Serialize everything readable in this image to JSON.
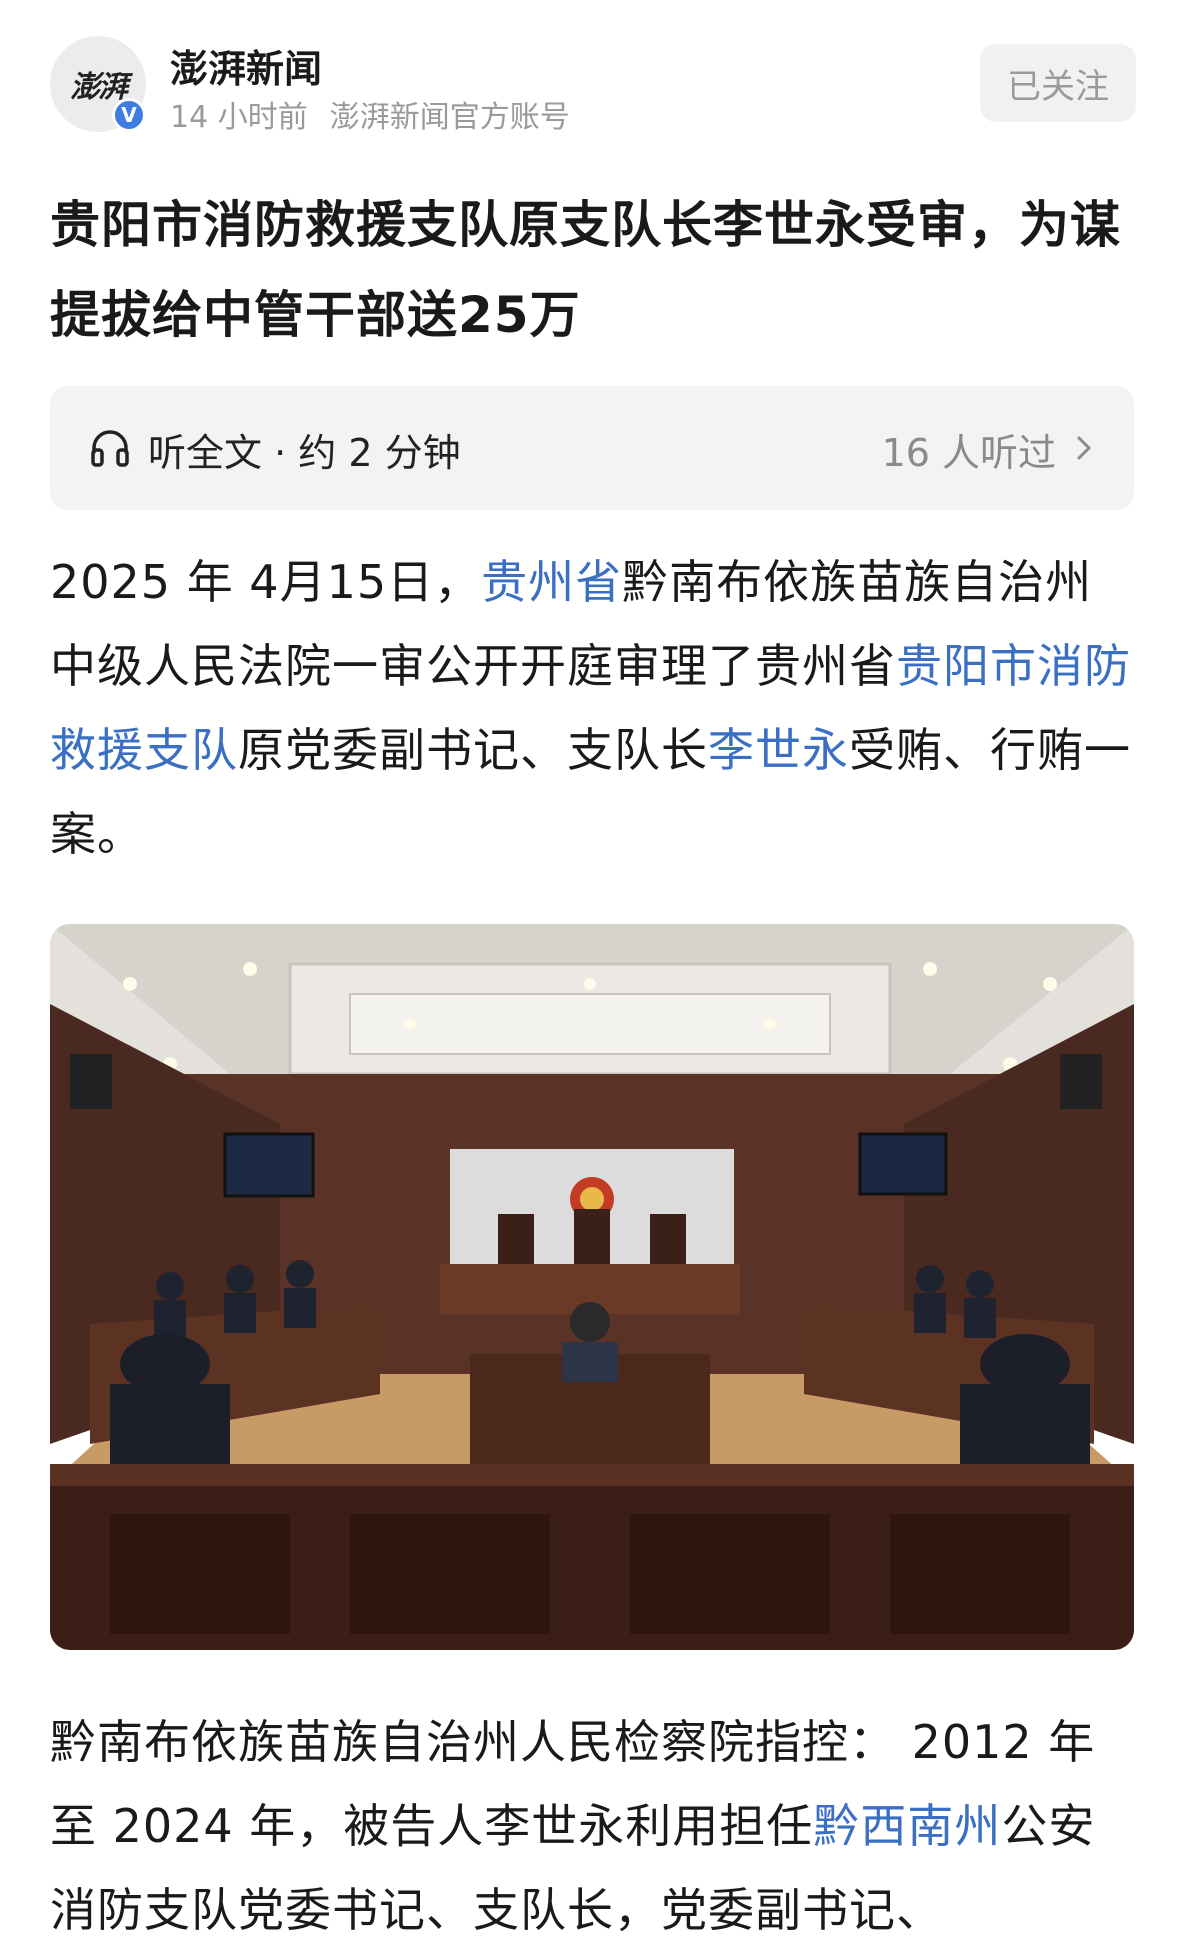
{
  "header": {
    "avatar_text": "澎湃",
    "verified_mark": "V",
    "author_name": "澎湃新闻",
    "time_ago": "14 小时前",
    "account_desc": "澎湃新闻官方账号",
    "follow_label": "已关注"
  },
  "title": "贵阳市消防救援支队原支队长李世永受审，为谋提拔给中管干部送25万",
  "listen": {
    "label": "听全文 · 约 2 分钟",
    "count": "16 人听过",
    "icon": "headphone-icon"
  },
  "paragraph1": {
    "s1": "2025 年 4月15日，",
    "link1": "贵州省",
    "s2": "黔南布依族苗族自治州中级人民法院一审公开开庭审理了贵州省",
    "link2": "贵阳市消防救援支队",
    "s3": "原党委副书记、支队长",
    "link3": "李世永",
    "s4": "受贿、行贿一案。"
  },
  "paragraph2": {
    "s1": "黔南布依族苗族自治州人民检察院指控： 2012 年至 2024 年，被告人李世永利用担任",
    "link1": "黔西南州",
    "s2": "公安消防支队党委书记、支队长，党委副书记、"
  },
  "colors": {
    "link": "#3a6fc4",
    "verified": "#3d7de0",
    "muted": "#9a9a9a"
  }
}
